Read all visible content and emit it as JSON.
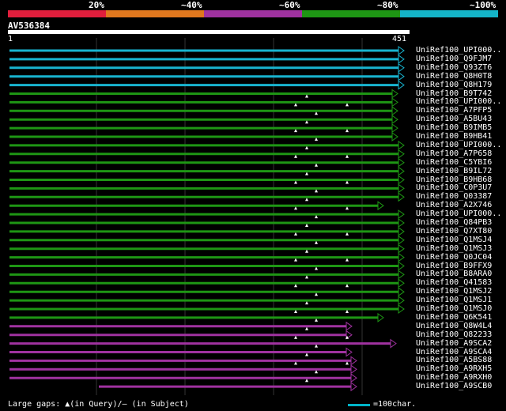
{
  "coverage_legend": [
    {
      "label": "20%",
      "color": "#e01e3c"
    },
    {
      "label": "~40%",
      "color": "#e0781e"
    },
    {
      "label": "~60%",
      "color": "#a032a0"
    },
    {
      "label": "~80%",
      "color": "#1e9614"
    },
    {
      "label": "~100%",
      "color": "#14b4c8"
    }
  ],
  "query": {
    "name": "AV536384",
    "start": "1",
    "end": "451"
  },
  "footer": {
    "gaps_text": "Large gaps: ▲(in Query)/– (in Subject)",
    "scale_text": "=100char."
  },
  "hits": [
    {
      "name": "UniRef100_UPI000..",
      "color": "cyan"
    },
    {
      "name": "UniRef100_Q9FJM7",
      "color": "cyan"
    },
    {
      "name": "UniRef100_Q93ZT6",
      "color": "cyan"
    },
    {
      "name": "UniRef100_Q8H0T8",
      "color": "cyan"
    },
    {
      "name": "UniRef100_Q8H179",
      "color": "cyan"
    },
    {
      "name": "UniRef100_B9T742",
      "color": "green"
    },
    {
      "name": "UniRef100_UPI000..",
      "color": "green"
    },
    {
      "name": "UniRef100_A7PFP5",
      "color": "green"
    },
    {
      "name": "UniRef100_A5BU43",
      "color": "green"
    },
    {
      "name": "UniRef100_B9IMB5",
      "color": "green"
    },
    {
      "name": "UniRef100_B9HB41",
      "color": "green"
    },
    {
      "name": "UniRef100_UPI000..",
      "color": "green"
    },
    {
      "name": "UniRef100_A7P658",
      "color": "green"
    },
    {
      "name": "UniRef100_C5YBI6",
      "color": "green"
    },
    {
      "name": "UniRef100_B9IL72",
      "color": "green"
    },
    {
      "name": "UniRef100_B9HB68",
      "color": "green"
    },
    {
      "name": "UniRef100_C0P3U7",
      "color": "green"
    },
    {
      "name": "UniRef100_Q03387",
      "color": "green"
    },
    {
      "name": "UniRef100_A2X746",
      "color": "green"
    },
    {
      "name": "UniRef100_UPI000..",
      "color": "green"
    },
    {
      "name": "UniRef100_Q84PB3",
      "color": "green"
    },
    {
      "name": "UniRef100_Q7XT80",
      "color": "green"
    },
    {
      "name": "UniRef100_Q1MSJ4",
      "color": "green"
    },
    {
      "name": "UniRef100_Q1MSJ3",
      "color": "green"
    },
    {
      "name": "UniRef100_Q0JC04",
      "color": "green"
    },
    {
      "name": "UniRef100_B9FFX9",
      "color": "green"
    },
    {
      "name": "UniRef100_B8ARA0",
      "color": "green"
    },
    {
      "name": "UniRef100_Q41583",
      "color": "green"
    },
    {
      "name": "UniRef100_Q1MSJ2",
      "color": "green"
    },
    {
      "name": "UniRef100_Q1MSJ1",
      "color": "green"
    },
    {
      "name": "UniRef100_Q1MSJ0",
      "color": "green"
    },
    {
      "name": "UniRef100_Q6K541",
      "color": "green"
    },
    {
      "name": "UniRef100_Q8W4L4",
      "color": "purple"
    },
    {
      "name": "UniRef100_Q82233",
      "color": "purple"
    },
    {
      "name": "UniRef100_A9SCA2",
      "color": "purple"
    },
    {
      "name": "UniRef100_A9SCA4",
      "color": "purple"
    },
    {
      "name": "UniRef100_A5BS88",
      "color": "purple"
    },
    {
      "name": "UniRef100_A9RXH5",
      "color": "purple"
    },
    {
      "name": "UniRef100_A9RXH0",
      "color": "purple"
    },
    {
      "name": "UniRef100_A9SCB0",
      "color": "purple"
    }
  ]
}
